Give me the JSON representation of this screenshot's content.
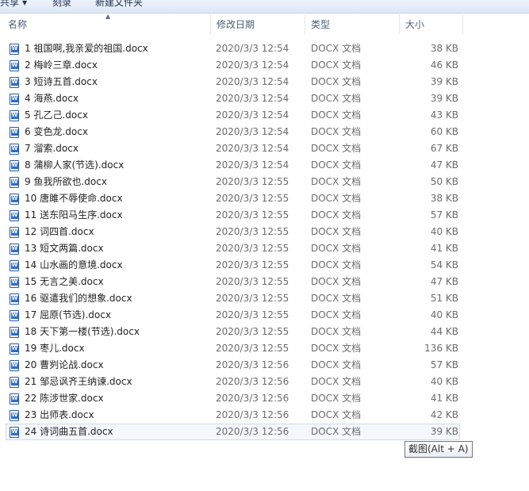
{
  "toolbar": {
    "share_label": "共享",
    "burn_label": "刻录",
    "new_folder_label": "新建文件夹"
  },
  "columns": {
    "name": "名称",
    "date": "修改日期",
    "type": "类型",
    "size": "大小"
  },
  "icons": {
    "sort": "sort-ascending-icon",
    "file": "word-document-icon",
    "dropdown": "chevron-down-icon"
  },
  "files": [
    {
      "name": "1   祖国啊,我亲爱的祖国.docx",
      "date": "2020/3/3 12:54",
      "type": "DOCX 文档",
      "size": "38 KB"
    },
    {
      "name": "2   梅岭三章.docx",
      "date": "2020/3/3 12:54",
      "type": "DOCX 文档",
      "size": "46 KB"
    },
    {
      "name": "3   短诗五首.docx",
      "date": "2020/3/3 12:54",
      "type": "DOCX 文档",
      "size": "39 KB"
    },
    {
      "name": "4   海燕.docx",
      "date": "2020/3/3 12:54",
      "type": "DOCX 文档",
      "size": "39 KB"
    },
    {
      "name": "5   孔乙己.docx",
      "date": "2020/3/3 12:54",
      "type": "DOCX 文档",
      "size": "43 KB"
    },
    {
      "name": "6   变色龙.docx",
      "date": "2020/3/3 12:54",
      "type": "DOCX 文档",
      "size": "60 KB"
    },
    {
      "name": "7   溜索.docx",
      "date": "2020/3/3 12:54",
      "type": "DOCX 文档",
      "size": "67 KB"
    },
    {
      "name": "8   蒲柳人家(节选).docx",
      "date": "2020/3/3 12:54",
      "type": "DOCX 文档",
      "size": "47 KB"
    },
    {
      "name": "9   鱼我所欲也.docx",
      "date": "2020/3/3 12:55",
      "type": "DOCX 文档",
      "size": "50 KB"
    },
    {
      "name": "10   唐雎不辱使命.docx",
      "date": "2020/3/3 12:55",
      "type": "DOCX 文档",
      "size": "38 KB"
    },
    {
      "name": "11   送东阳马生序.docx",
      "date": "2020/3/3 12:55",
      "type": "DOCX 文档",
      "size": "57 KB"
    },
    {
      "name": "12   词四首.docx",
      "date": "2020/3/3 12:55",
      "type": "DOCX 文档",
      "size": "40 KB"
    },
    {
      "name": "13   短文两篇.docx",
      "date": "2020/3/3 12:55",
      "type": "DOCX 文档",
      "size": "41 KB"
    },
    {
      "name": "14   山水画的意境.docx",
      "date": "2020/3/3 12:55",
      "type": "DOCX 文档",
      "size": "54 KB"
    },
    {
      "name": "15   无言之美.docx",
      "date": "2020/3/3 12:55",
      "type": "DOCX 文档",
      "size": "47 KB"
    },
    {
      "name": "16   驱遣我们的想象.docx",
      "date": "2020/3/3 12:55",
      "type": "DOCX 文档",
      "size": "51 KB"
    },
    {
      "name": "17   屈原(节选).docx",
      "date": "2020/3/3 12:55",
      "type": "DOCX 文档",
      "size": "40 KB"
    },
    {
      "name": "18   天下第一楼(节选).docx",
      "date": "2020/3/3 12:55",
      "type": "DOCX 文档",
      "size": "44 KB"
    },
    {
      "name": "19   枣儿.docx",
      "date": "2020/3/3 12:55",
      "type": "DOCX 文档",
      "size": "136 KB"
    },
    {
      "name": "20   曹刿论战.docx",
      "date": "2020/3/3 12:56",
      "type": "DOCX 文档",
      "size": "57 KB"
    },
    {
      "name": "21   邹忌讽齐王纳谏.docx",
      "date": "2020/3/3 12:56",
      "type": "DOCX 文档",
      "size": "40 KB"
    },
    {
      "name": "22   陈涉世家.docx",
      "date": "2020/3/3 12:56",
      "type": "DOCX 文档",
      "size": "41 KB"
    },
    {
      "name": "23   出师表.docx",
      "date": "2020/3/3 12:56",
      "type": "DOCX 文档",
      "size": "42 KB"
    },
    {
      "name": "24   诗词曲五首.docx",
      "date": "2020/3/3 12:56",
      "type": "DOCX 文档",
      "size": "39 KB"
    }
  ],
  "selected_index": 23,
  "tooltip": "截图(Alt + A)"
}
